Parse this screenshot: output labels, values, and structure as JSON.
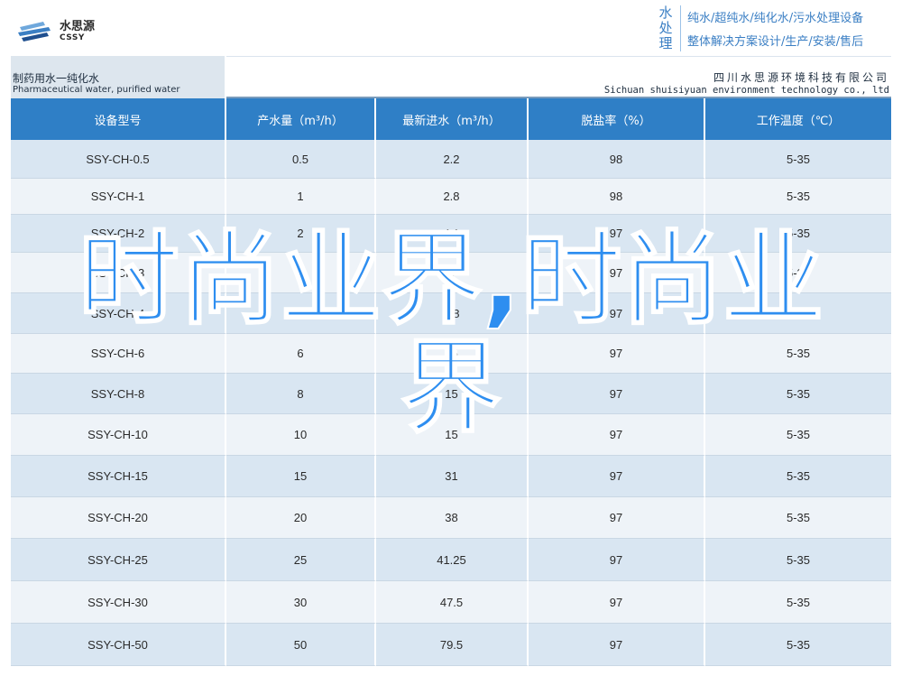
{
  "logo": {
    "cn": "水思源",
    "en": "CSSY"
  },
  "brand": {
    "vertical": "水处理",
    "line1": "纯水/超纯水/纯化水/污水处理设备",
    "line2": "整体解决方案设计/生产/安装/售后"
  },
  "title": {
    "cn": "制药用水一纯化水",
    "en": "Pharmaceutical water, purified water"
  },
  "company": {
    "cn": "四川水思源环境科技有限公司",
    "en": "Sichuan shuisiyuan environment technology co., ltd"
  },
  "table": {
    "headers": [
      "设备型号",
      "产水量（m³/h）",
      "最新进水（m³/h）",
      "脱盐率（%）",
      "工作温度（℃）"
    ],
    "rows": [
      [
        "SSY-CH-0.5",
        "0.5",
        "2.2",
        "98",
        "5-35"
      ],
      [
        "SSY-CH-1",
        "1",
        "2.8",
        "98",
        "5-35"
      ],
      [
        "SSY-CH-2",
        "2",
        "4.1",
        "97",
        "5-35"
      ],
      [
        "SSY-CH-3",
        "3",
        "5",
        "97",
        "5-35"
      ],
      [
        "SSY-CH-4",
        "4",
        "7.8",
        "97",
        "5-35"
      ],
      [
        "SSY-CH-6",
        "6",
        "25",
        "97",
        "5-35"
      ],
      [
        "SSY-CH-8",
        "8",
        "15",
        "97",
        "5-35"
      ],
      [
        "SSY-CH-10",
        "10",
        "15",
        "97",
        "5-35"
      ],
      [
        "SSY-CH-15",
        "15",
        "31",
        "97",
        "5-35"
      ],
      [
        "SSY-CH-20",
        "20",
        "38",
        "97",
        "5-35"
      ],
      [
        "SSY-CH-25",
        "25",
        "41.25",
        "97",
        "5-35"
      ],
      [
        "SSY-CH-30",
        "30",
        "47.5",
        "97",
        "5-35"
      ],
      [
        "SSY-CH-50",
        "50",
        "79.5",
        "97",
        "5-35"
      ]
    ]
  },
  "overlay": {
    "text": "时尚业界,时尚业界"
  },
  "colors": {
    "header_blue": "#2f7fc6",
    "overlay_blue": "#2e8ef0",
    "row_odd": "#d9e6f2",
    "row_even": "#eef3f8"
  }
}
